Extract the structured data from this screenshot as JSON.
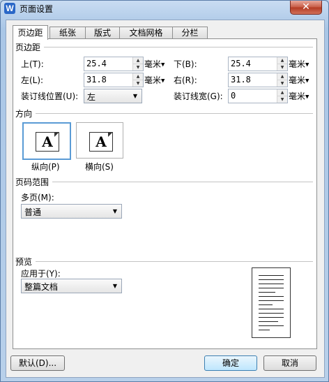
{
  "window": {
    "title": "页面设置",
    "app_icon": "W",
    "close_glyph": "✕"
  },
  "tabs": [
    "页边距",
    "纸张",
    "版式",
    "文档网格",
    "分栏"
  ],
  "margins": {
    "section_title": "页边距",
    "top_label": "上(T):",
    "top_value": "25.4",
    "bottom_label": "下(B):",
    "bottom_value": "25.4",
    "left_label": "左(L):",
    "left_value": "31.8",
    "right_label": "右(R):",
    "right_value": "31.8",
    "gutter_pos_label": "装订线位置(U):",
    "gutter_pos_value": "左",
    "gutter_width_label": "装订线宽(G):",
    "gutter_width_value": "0",
    "unit": "毫米"
  },
  "orientation": {
    "section_title": "方向",
    "portrait_label": "纵向(P)",
    "landscape_label": "横向(S)",
    "icon_letter": "A"
  },
  "page_range": {
    "section_title": "页码范围",
    "multi_label": "多页(M):",
    "multi_value": "普通"
  },
  "preview": {
    "section_title": "预览",
    "apply_label": "应用于(Y):",
    "apply_value": "整篇文档"
  },
  "buttons": {
    "default": "默认(D)...",
    "ok": "确定",
    "cancel": "取消"
  },
  "colors": {
    "accent": "#5a9bd5",
    "close": "#c75a44",
    "titlebar": "#b9d1ea"
  }
}
